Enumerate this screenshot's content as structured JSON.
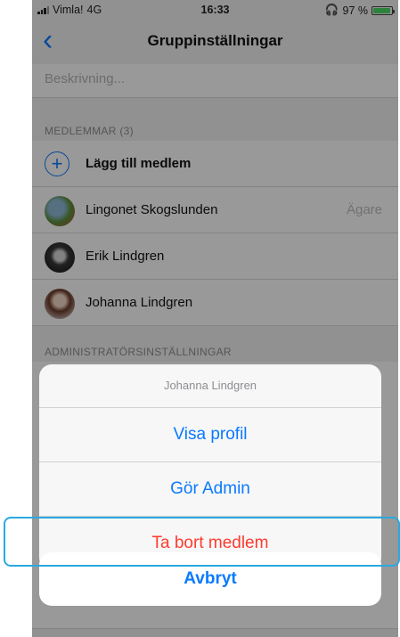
{
  "status_bar": {
    "carrier": "Vimla!",
    "network": "4G",
    "time": "16:33",
    "headphones": "headphones-icon",
    "battery": "97 %",
    "battery_level": 0.97
  },
  "nav": {
    "title": "Gruppinställningar",
    "back_icon": "chevron-left-icon"
  },
  "description_placeholder": "Beskrivning...",
  "members_section": {
    "label": "MEDLEMMAR (3)",
    "add_label": "Lägg till medlem",
    "members": [
      {
        "name": "Lingonet Skogslunden",
        "role": "Ägare"
      },
      {
        "name": "Erik Lindgren",
        "role": ""
      },
      {
        "name": "Johanna Lindgren",
        "role": ""
      }
    ]
  },
  "admin_section": {
    "label": "ADMINISTRATÖRSINSTÄLLNINGAR"
  },
  "action_sheet": {
    "title": "Johanna Lindgren",
    "actions": [
      "Visa profil",
      "Gör Admin",
      "Ta bort medlem"
    ],
    "cancel": "Avbryt"
  },
  "colors": {
    "accent": "#0a7aff",
    "destructive": "#ff3b30",
    "highlight": "#2aa9e0"
  }
}
